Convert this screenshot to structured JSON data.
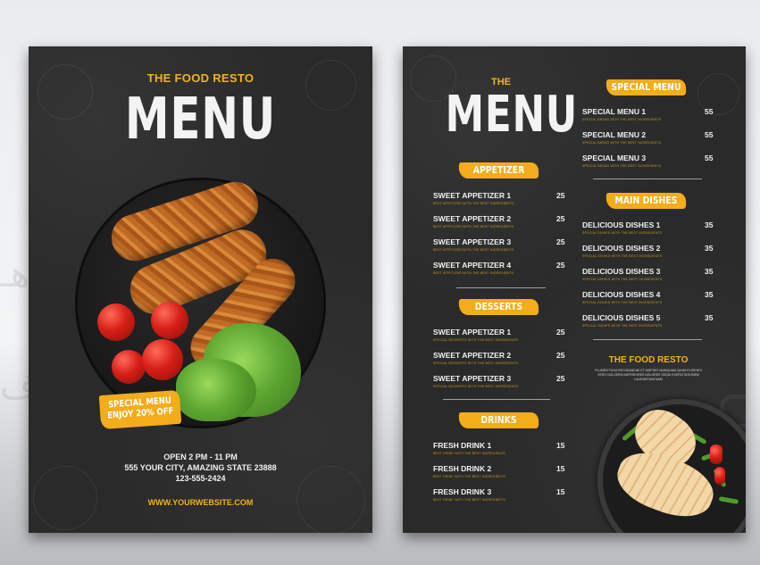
{
  "left_page": {
    "brand": "THE FOOD RESTO",
    "title": "MENU",
    "promo_line1": "SPECIAL MENU",
    "promo_line2": "ENJOY 20% OFF",
    "hours": "OPEN 2 PM - 11 PM",
    "address": "555 YOUR CITY, AMAZING STATE 23888",
    "phone": "123-555-2424",
    "website": "WWW.YOURWEBSITE.COM"
  },
  "right_page": {
    "title_small": "THE",
    "title": "MENU",
    "appetizer": {
      "heading": "APPETIZER",
      "items": [
        {
          "name": "SWEET APPETIZER 1",
          "desc": "BEST APPETIZER WITH THE BEST INGREDIENTS",
          "price": "25"
        },
        {
          "name": "SWEET APPETIZER 2",
          "desc": "BEST APPETIZER WITH THE BEST INGREDIENTS",
          "price": "25"
        },
        {
          "name": "SWEET APPETIZER 3",
          "desc": "BEST APPETIZER WITH THE BEST INGREDIENTS",
          "price": "25"
        },
        {
          "name": "SWEET APPETIZER 4",
          "desc": "BEST APPETIZER WITH THE BEST INGREDIENTS",
          "price": "25"
        }
      ]
    },
    "desserts": {
      "heading": "DESSERTS",
      "items": [
        {
          "name": "SWEET APPETIZER 1",
          "desc": "SPECIAL DESSERTS WITH THE BEST INGREDIENTS",
          "price": "25"
        },
        {
          "name": "SWEET APPETIZER 2",
          "desc": "SPECIAL DESSERTS WITH THE BEST INGREDIENTS",
          "price": "25"
        },
        {
          "name": "SWEET APPETIZER 3",
          "desc": "SPECIAL DESSERTS WITH THE BEST INGREDIENTS",
          "price": "25"
        }
      ]
    },
    "drinks": {
      "heading": "DRINKS",
      "items": [
        {
          "name": "FRESH DRINK 1",
          "desc": "BEST DRINK WITH THE BEST INGREDIENTS",
          "price": "15"
        },
        {
          "name": "FRESH DRINK 2",
          "desc": "BEST DRINK WITH THE BEST INGREDIENTS",
          "price": "15"
        },
        {
          "name": "FRESH DRINK 3",
          "desc": "BEST DRINK WITH THE BEST INGREDIENTS",
          "price": "15"
        }
      ]
    },
    "special": {
      "heading": "SPECIAL MENU",
      "items": [
        {
          "name": "SPECIAL MENU 1",
          "desc": "SPECIAL BREAD WITH THE BEST INGREDIENTS",
          "price": "55"
        },
        {
          "name": "SPECIAL MENU 2",
          "desc": "SPECIAL BREAD WITH THE BEST INGREDIENTS",
          "price": "55"
        },
        {
          "name": "SPECIAL MENU 3",
          "desc": "SPECIAL BREAD WITH THE BEST INGREDIENTS",
          "price": "55"
        }
      ]
    },
    "main": {
      "heading": "MAIN DISHES",
      "items": [
        {
          "name": "DELICIOUS DISHES 1",
          "desc": "SPECIAL DISHES WITH THE BEST INGREDIENTS",
          "price": "35"
        },
        {
          "name": "DELICIOUS DISHES 2",
          "desc": "SPECIAL DISHES WITH THE BEST INGREDIENTS",
          "price": "35"
        },
        {
          "name": "DELICIOUS DISHES 3",
          "desc": "SPECIAL DISHES WITH THE BEST INGREDIENTS",
          "price": "35"
        },
        {
          "name": "DELICIOUS DISHES 4",
          "desc": "SPECIAL DISHES WITH THE BEST INGREDIENTS",
          "price": "35"
        },
        {
          "name": "DELICIOUS DISHES 5",
          "desc": "SPECIAL DISHES WITH THE BEST INGREDIENTS",
          "price": "35"
        }
      ]
    },
    "footer_brand": "THE FOOD RESTO",
    "footer_blurb": "FLUMEN FUGA RECUSANDAE ET ADIPISCI NUMQUAM QUAM ELIGENDI VERO DOLOREM ASPERIORES DOLORES SEQUI EXERCITATIONEM LAUDANTIUM NAM"
  },
  "colors": {
    "accent": "#f2ac1c",
    "board": "#2a2a2a",
    "text": "#f1f1f1"
  }
}
